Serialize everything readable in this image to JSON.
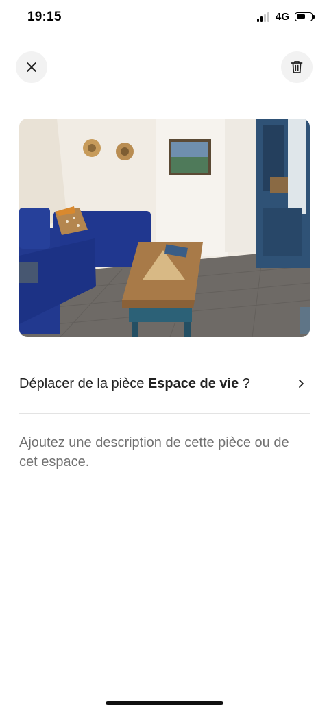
{
  "status_bar": {
    "time": "19:15",
    "network": "4G",
    "battery_level": 0.6
  },
  "header": {
    "close_icon": "close-icon",
    "delete_icon": "trash-icon"
  },
  "photo": {
    "subject": "living room with blue corner sofa and wooden coffee table"
  },
  "move_room": {
    "prefix": "Déplacer de la pièce ",
    "room": "Espace de vie",
    "suffix": " ?"
  },
  "description": {
    "placeholder": "Ajoutez une description de cette pièce ou de cet espace."
  },
  "colors": {
    "text": "#222222",
    "muted": "#717171",
    "divider": "#e3e3e3",
    "button_bg": "#f2f2f2"
  }
}
